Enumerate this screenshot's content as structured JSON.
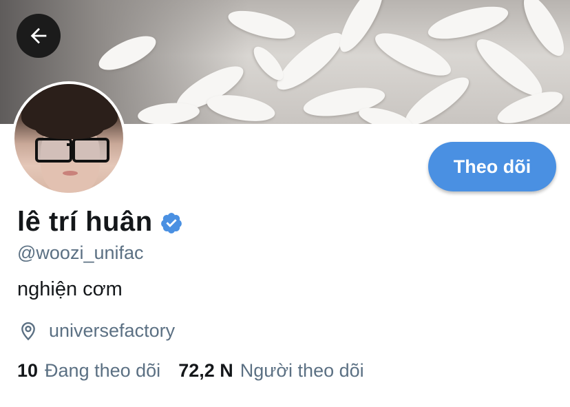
{
  "header": {
    "back_icon": "arrow-left-icon"
  },
  "profile": {
    "display_name": "lê trí huân",
    "verified_icon": "verified-badge-icon",
    "handle": "@woozi_unifac",
    "bio": "nghiện cơm",
    "location_icon": "location-pin-icon",
    "location": "universefactory",
    "follow_label": "Theo dõi"
  },
  "stats": {
    "following_count": "10",
    "following_label": "Đang theo dõi",
    "followers_count": "72,2 N",
    "followers_label": "Người theo dõi"
  },
  "colors": {
    "accent": "#4a90e2",
    "verified": "#4a90e2",
    "secondary_text": "#5b7083",
    "primary_text": "#14171a"
  }
}
